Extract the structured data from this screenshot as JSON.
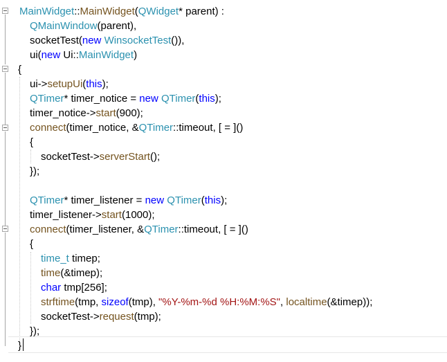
{
  "colors": {
    "keyword": "#0000ff",
    "type": "#2b91af",
    "function": "#74531f",
    "string": "#a31515",
    "plain": "#000000"
  },
  "code_lines": [
    [
      {
        "t": "MainWidget",
        "c": "type"
      },
      {
        "t": "::",
        "c": "plain"
      },
      {
        "t": "MainWidget",
        "c": "function"
      },
      {
        "t": "(",
        "c": "plain"
      },
      {
        "t": "QWidget",
        "c": "type"
      },
      {
        "t": "* parent) :",
        "c": "plain"
      }
    ],
    [
      {
        "t": "QMainWindow",
        "c": "type"
      },
      {
        "t": "(parent),",
        "c": "plain"
      }
    ],
    [
      {
        "t": "socketTest(",
        "c": "plain"
      },
      {
        "t": "new",
        "c": "keyword"
      },
      {
        "t": " ",
        "c": "plain"
      },
      {
        "t": "WinsocketTest",
        "c": "type"
      },
      {
        "t": "()),",
        "c": "plain"
      }
    ],
    [
      {
        "t": "ui(",
        "c": "plain"
      },
      {
        "t": "new",
        "c": "keyword"
      },
      {
        "t": " Ui::",
        "c": "plain"
      },
      {
        "t": "MainWidget",
        "c": "type"
      },
      {
        "t": ")",
        "c": "plain"
      }
    ],
    [
      {
        "t": "{",
        "c": "plain"
      }
    ],
    [
      {
        "t": "ui->",
        "c": "plain"
      },
      {
        "t": "setupUi",
        "c": "function"
      },
      {
        "t": "(",
        "c": "plain"
      },
      {
        "t": "this",
        "c": "keyword"
      },
      {
        "t": ");",
        "c": "plain"
      }
    ],
    [
      {
        "t": "QTimer",
        "c": "type"
      },
      {
        "t": "* timer_notice = ",
        "c": "plain"
      },
      {
        "t": "new",
        "c": "keyword"
      },
      {
        "t": " ",
        "c": "plain"
      },
      {
        "t": "QTimer",
        "c": "type"
      },
      {
        "t": "(",
        "c": "plain"
      },
      {
        "t": "this",
        "c": "keyword"
      },
      {
        "t": ");",
        "c": "plain"
      }
    ],
    [
      {
        "t": "timer_notice->",
        "c": "plain"
      },
      {
        "t": "start",
        "c": "function"
      },
      {
        "t": "(900);",
        "c": "plain"
      }
    ],
    [
      {
        "t": "connect",
        "c": "function"
      },
      {
        "t": "(timer_notice, &",
        "c": "plain"
      },
      {
        "t": "QTimer",
        "c": "type"
      },
      {
        "t": "::timeout, [ = ]()",
        "c": "plain"
      }
    ],
    [
      {
        "t": "{",
        "c": "plain"
      }
    ],
    [
      {
        "t": "socketTest->",
        "c": "plain"
      },
      {
        "t": "serverStart",
        "c": "function"
      },
      {
        "t": "();",
        "c": "plain"
      }
    ],
    [
      {
        "t": "});",
        "c": "plain"
      }
    ],
    [],
    [
      {
        "t": "QTimer",
        "c": "type"
      },
      {
        "t": "* timer_listener = ",
        "c": "plain"
      },
      {
        "t": "new",
        "c": "keyword"
      },
      {
        "t": " ",
        "c": "plain"
      },
      {
        "t": "QTimer",
        "c": "type"
      },
      {
        "t": "(",
        "c": "plain"
      },
      {
        "t": "this",
        "c": "keyword"
      },
      {
        "t": ");",
        "c": "plain"
      }
    ],
    [
      {
        "t": "timer_listener->",
        "c": "plain"
      },
      {
        "t": "start",
        "c": "function"
      },
      {
        "t": "(1000);",
        "c": "plain"
      }
    ],
    [
      {
        "t": "connect",
        "c": "function"
      },
      {
        "t": "(timer_listener, &",
        "c": "plain"
      },
      {
        "t": "QTimer",
        "c": "type"
      },
      {
        "t": "::timeout, [ = ]()",
        "c": "plain"
      }
    ],
    [
      {
        "t": "{",
        "c": "plain"
      }
    ],
    [
      {
        "t": "time_t",
        "c": "type"
      },
      {
        "t": " timep;",
        "c": "plain"
      }
    ],
    [
      {
        "t": "time",
        "c": "function"
      },
      {
        "t": "(&timep);",
        "c": "plain"
      }
    ],
    [
      {
        "t": "char",
        "c": "keyword"
      },
      {
        "t": " tmp[256];",
        "c": "plain"
      }
    ],
    [
      {
        "t": "strftime",
        "c": "function"
      },
      {
        "t": "(tmp, ",
        "c": "plain"
      },
      {
        "t": "sizeof",
        "c": "keyword"
      },
      {
        "t": "(tmp), ",
        "c": "plain"
      },
      {
        "t": "\"%Y-%m-%d %H:%M:%S\"",
        "c": "string"
      },
      {
        "t": ", ",
        "c": "plain"
      },
      {
        "t": "localtime",
        "c": "function"
      },
      {
        "t": "(&timep));",
        "c": "plain"
      }
    ],
    [
      {
        "t": "socketTest->",
        "c": "plain"
      },
      {
        "t": "request",
        "c": "function"
      },
      {
        "t": "(tmp);",
        "c": "plain"
      }
    ],
    [
      {
        "t": "});",
        "c": "plain"
      }
    ],
    [
      {
        "t": "}",
        "c": "plain"
      }
    ]
  ]
}
